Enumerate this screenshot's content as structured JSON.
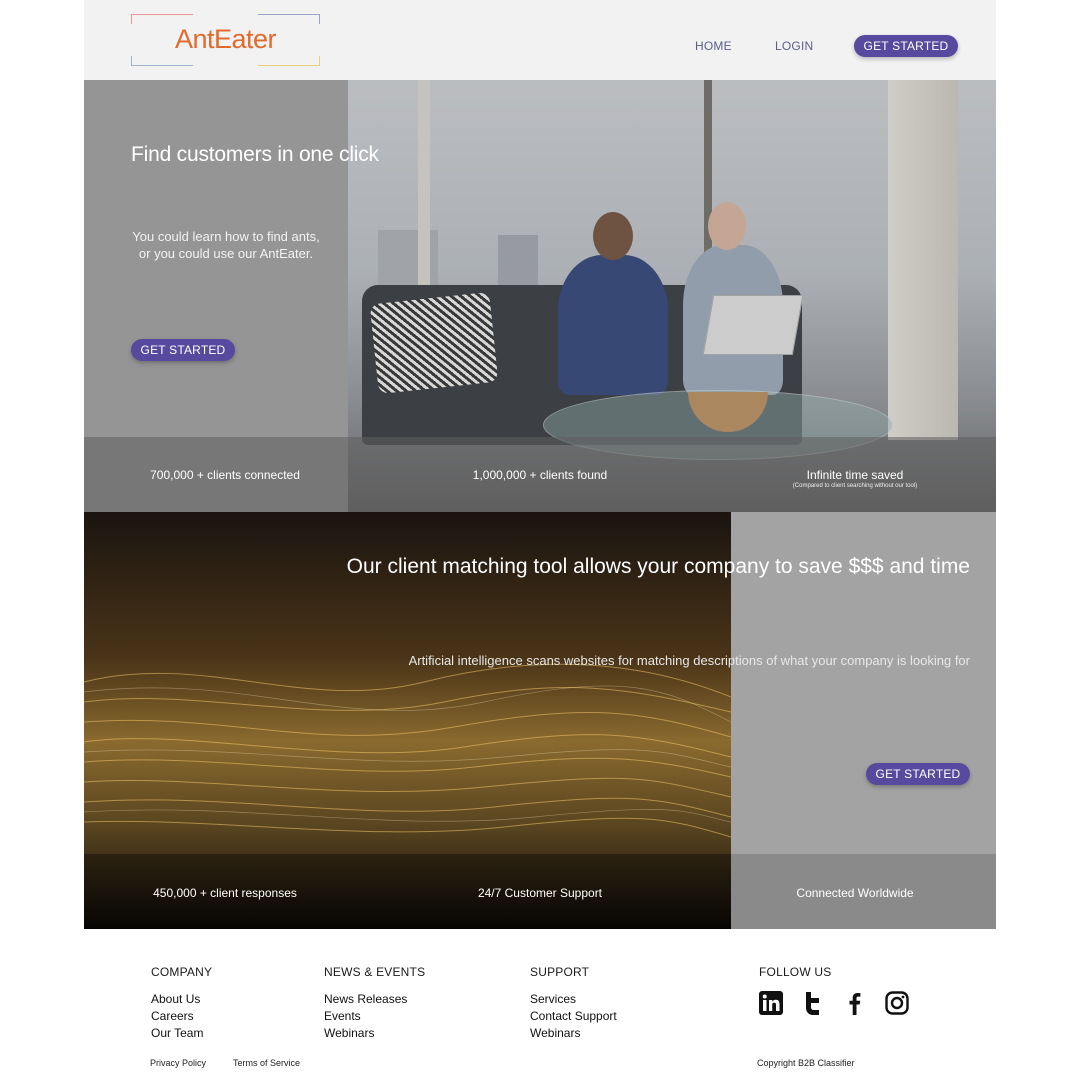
{
  "brand": {
    "name": "AntEater",
    "accent": "#574a9e",
    "logo_color": "#e26a2c"
  },
  "nav": {
    "home": "HOME",
    "login": "LOGIN",
    "cta": "GET STARTED"
  },
  "hero": {
    "title": "Find customers in one click",
    "subtitle": "You could learn how to find ants, or you could use our AntEater.",
    "cta": "GET STARTED",
    "stats": [
      {
        "label": "700,000 + clients connected"
      },
      {
        "label": "1,000,000 + clients found"
      },
      {
        "label": "Infinite time saved",
        "note": "(Compared to client searching without our tool)"
      }
    ]
  },
  "section2": {
    "title": "Our client matching tool allows your company to save $$$ and time",
    "subtitle": "Artificial intelligence scans websites for matching descriptions of what your company is looking for",
    "cta": "GET STARTED",
    "stats": [
      {
        "label": "450,000 + client responses"
      },
      {
        "label": "24/7 Customer Support"
      },
      {
        "label": "Connected Worldwide"
      }
    ]
  },
  "footer": {
    "company": {
      "heading": "COMPANY",
      "links": [
        "About Us",
        "Careers",
        "Our Team"
      ]
    },
    "news": {
      "heading": "NEWS & EVENTS",
      "links": [
        "News Releases",
        "Events",
        "Webinars"
      ]
    },
    "support": {
      "heading": "SUPPORT",
      "links": [
        "Services",
        "Contact Support",
        "Webinars"
      ]
    },
    "follow": {
      "heading": "FOLLOW US",
      "icons": [
        "linkedin-icon",
        "twitter-icon",
        "facebook-icon",
        "instagram-icon"
      ]
    },
    "privacy": "Privacy Policy",
    "terms": "Terms of Service",
    "copyright": "Copyright B2B Classifier"
  }
}
